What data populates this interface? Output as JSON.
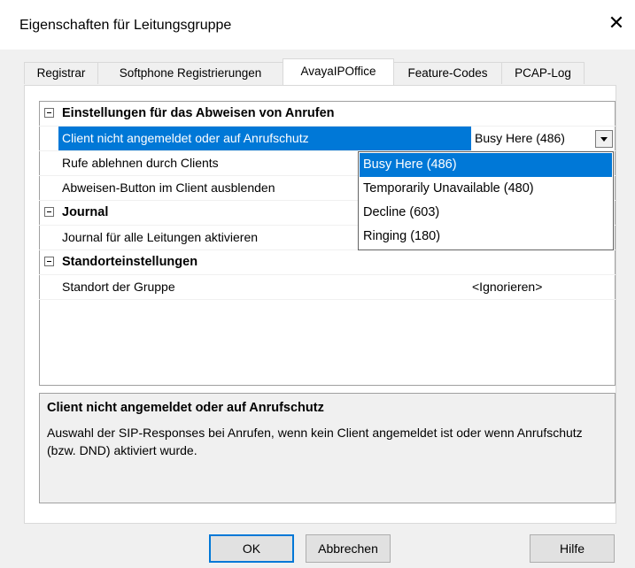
{
  "window": {
    "title": "Eigenschaften für Leitungsgruppe"
  },
  "tabs": [
    {
      "label": "Registrar"
    },
    {
      "label": "Softphone Registrierungen"
    },
    {
      "label": "AvayaIPOffice",
      "active": true
    },
    {
      "label": "Feature-Codes"
    },
    {
      "label": "PCAP-Log"
    }
  ],
  "grid": {
    "categories": [
      {
        "label": "Einstellungen für das Abweisen von Anrufen"
      },
      {
        "label": "Journal"
      },
      {
        "label": "Standorteinstellungen"
      }
    ],
    "properties": [
      {
        "label": "Client nicht angemeldet oder auf Anrufschutz",
        "value": "Busy Here (486)",
        "selected": true
      },
      {
        "label": "Rufe ablehnen durch Clients",
        "value": ""
      },
      {
        "label": "Abweisen-Button im Client ausblenden",
        "value": ""
      },
      {
        "label": "Journal für alle Leitungen aktivieren",
        "value": ""
      },
      {
        "label": "Standort der Gruppe",
        "value": "<Ignorieren>"
      }
    ]
  },
  "dropdown": {
    "options": [
      {
        "label": "Busy Here (486)",
        "selected": true
      },
      {
        "label": "Temporarily Unavailable (480)"
      },
      {
        "label": "Decline (603)"
      },
      {
        "label": "Ringing (180)"
      }
    ]
  },
  "description": {
    "title": "Client nicht angemeldet oder auf Anrufschutz",
    "text": "Auswahl der SIP-Responses bei Anrufen, wenn kein Client angemeldet ist oder wenn Anrufschutz (bzw. DND) aktiviert wurde."
  },
  "buttons": {
    "ok": "OK",
    "cancel": "Abbrechen",
    "help": "Hilfe"
  },
  "icons": {
    "close": "close-icon",
    "collapse": "collapse-icon",
    "dropdown": "chevron-down-icon"
  },
  "colors": {
    "selection": "#0078d7",
    "dialog_bg": "#f0f0f0"
  }
}
